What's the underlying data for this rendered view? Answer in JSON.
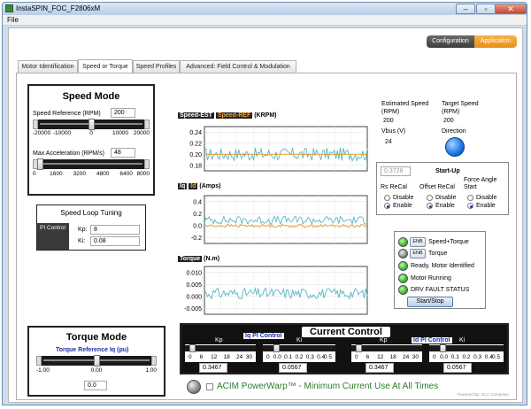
{
  "window": {
    "title": "InstaSPIN_FOC_F2806xM",
    "min": "–",
    "max": "▫",
    "close": "✕"
  },
  "menu": {
    "file": "File"
  },
  "mode_switch": {
    "configuration": "Configuration",
    "application": "Application"
  },
  "tabs": [
    "Motor Identification",
    "Speed or Torque",
    "Speed Profiles",
    "Advanced: Field Control & Modulation"
  ],
  "speed_mode": {
    "title": "Speed Mode",
    "speed_ref_label": "Speed Reference (RPM)",
    "speed_ref_value": "200",
    "speed_ticks": [
      "-20000",
      "-10000",
      "0",
      "10000",
      "20000"
    ],
    "speed_level": 0.505,
    "max_accel_label": "Max Acceleration (RPM/s)",
    "max_accel_value": "48",
    "accel_ticks": [
      "0",
      "1600",
      "3200",
      "4800",
      "6400",
      "8000"
    ],
    "accel_level": 0.006
  },
  "speed_loop": {
    "title": "Speed Loop Tuning",
    "pi_label": "PI Control",
    "kp_label": "Kp:",
    "kp_value": "8",
    "ki_label": "Ki:",
    "ki_value": "0.08"
  },
  "charts": {
    "speed": {
      "tag1": "Speed-EST",
      "tag2": "Speed-REF",
      "unit": "(KRPM)",
      "ticks": [
        "0.24",
        "0.22",
        "0.20",
        "0.18"
      ]
    },
    "current": {
      "tag1": "Iq",
      "tag2": "Id",
      "unit": "(Amps)",
      "ticks": [
        "0.4",
        "0.2",
        "0.0",
        "-0.2"
      ]
    },
    "torque": {
      "tag1": "Torque",
      "unit": "(N.m)",
      "ticks": [
        "0.010",
        "0.005",
        "0.000",
        "-0.005"
      ]
    }
  },
  "chart_data": [
    {
      "type": "line",
      "series": [
        {
          "name": "Speed-EST",
          "color": "#55b7c4",
          "range": [
            0.188,
            0.212
          ]
        },
        {
          "name": "Speed-REF",
          "color": "#e89a2a",
          "values": [
            0.2
          ]
        }
      ],
      "ylim": [
        0.17,
        0.25
      ]
    },
    {
      "type": "line",
      "series": [
        {
          "name": "Iq",
          "color": "#55b7c4",
          "range": [
            0.02,
            0.16
          ]
        },
        {
          "name": "Id",
          "color": "#e89a2a",
          "range": [
            -0.03,
            0.02
          ]
        }
      ],
      "ylim": [
        -0.3,
        0.5
      ]
    },
    {
      "type": "line",
      "series": [
        {
          "name": "Torque",
          "color": "#55b7c4",
          "range": [
            -0.001,
            0.0035
          ]
        }
      ],
      "ylim": [
        -0.0075,
        0.0125
      ]
    }
  ],
  "status": {
    "est_speed_label": "Estimated Speed (RPM)",
    "est_speed_value": "200",
    "target_speed_label": "Target Speed (RPM)",
    "target_speed_value": "200",
    "vbus_label": "Vbus (V)",
    "vbus_value": "24",
    "direction_label": "Direction"
  },
  "startup": {
    "title": "Start-Up",
    "rs_value": "0.3728",
    "rs_recal": "Rs ReCal",
    "offset_recal": "Offset ReCal",
    "force_angle": "Force Angle Start",
    "disable": "Disable",
    "enable": "Enable"
  },
  "flags": {
    "enb": "ENB",
    "speed_torque": "Speed+Torque",
    "torque": "Torque",
    "ready": "Ready, Motor Identified",
    "running": "Motor Running",
    "drv_fault": "DRV FAULT STATUS",
    "start_stop": "Start/Stop"
  },
  "torque_mode": {
    "title": "Torque Mode",
    "ref_label": "Torque Reference Iq (pu)",
    "ticks": [
      "-1.00",
      "0.00",
      "1.00"
    ],
    "level": 0.5,
    "value": "0.0"
  },
  "current_control": {
    "title": "Current Control",
    "iq_label": "Iq PI Control",
    "id_label": "Id PI Control",
    "kp": "Kp",
    "ki": "Ki",
    "kp_ticks": [
      "0",
      "6",
      "12",
      "18",
      "24",
      "30"
    ],
    "ki_ticks": [
      "0",
      "0.0",
      "0.1",
      "0.2",
      "0.3",
      "0.4",
      "0.5"
    ],
    "iq_kp_value": "0.3467",
    "iq_ki_value": "0.0567",
    "id_kp_value": "0.3467",
    "id_ki_value": "0.0567",
    "kp_level": 0.0116,
    "ki_level": 0.113
  },
  "powerwarp": {
    "text": "ACIM PowerWarp™ - Minimum Current Use At All Times"
  },
  "footer": {
    "powered_by": "Powered By: OLU Composer"
  }
}
